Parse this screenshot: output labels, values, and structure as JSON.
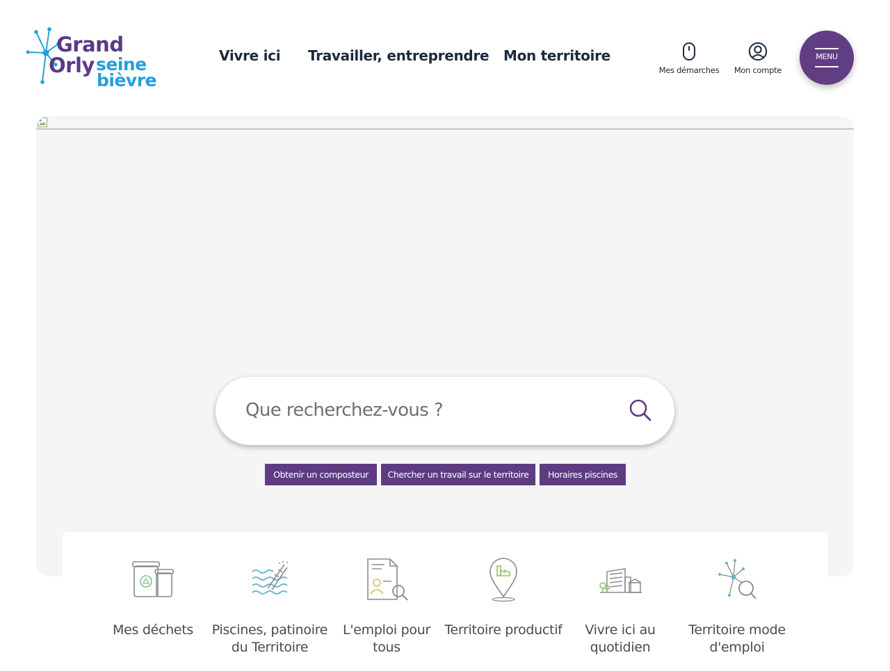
{
  "brand": {
    "logo_line1": "Grand",
    "logo_line2a": "Orly",
    "logo_line2b": "seine",
    "logo_line3": "bièvre",
    "primary_color": "#5e3b83",
    "secondary_color": "#24a0d8"
  },
  "nav": [
    {
      "label": "Vivre ici"
    },
    {
      "label": "Travailler, entreprendre"
    },
    {
      "label": "Mon territoire"
    }
  ],
  "utilities": {
    "demarches_label": "Mes démarches",
    "demarches_icon": "mouse-icon",
    "account_label": "Mon compte",
    "account_icon": "user-circle-icon"
  },
  "menu_button": {
    "label": "MENU"
  },
  "search": {
    "placeholder": "Que recherchez-vous ?"
  },
  "quick_links": [
    {
      "label": "Obtenir un composteur"
    },
    {
      "label": "Chercher un travail sur le territoire"
    },
    {
      "label": "Horaires piscines"
    }
  ],
  "shortcuts": [
    {
      "label": "Mes déchets",
      "icon": "waste-bins-icon"
    },
    {
      "label": "Piscines, patinoire du Territoire",
      "icon": "pool-waves-icon"
    },
    {
      "label": "L'emploi pour tous",
      "icon": "job-document-search-icon"
    },
    {
      "label": "Territoire productif",
      "icon": "map-pin-factory-icon"
    },
    {
      "label": "Vivre ici au quotidien",
      "icon": "city-buildings-icon"
    },
    {
      "label": "Territoire mode d'emploi",
      "icon": "network-search-icon"
    }
  ]
}
